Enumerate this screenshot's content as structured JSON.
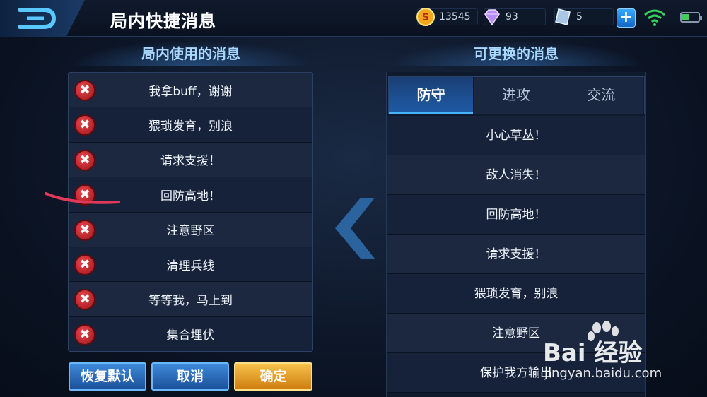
{
  "header": {
    "title": "局内快捷消息",
    "back_icon": "back-arrow-icon"
  },
  "resources": {
    "gold": "13545",
    "diamond": "93",
    "voucher": "5"
  },
  "left_panel": {
    "title": "局内使用的消息",
    "remove_glyph": "✖",
    "items": [
      {
        "label": "我拿buff，谢谢"
      },
      {
        "label": "猥琐发育，别浪"
      },
      {
        "label": "请求支援！"
      },
      {
        "label": "回防高地！"
      },
      {
        "label": "注意野区"
      },
      {
        "label": "清理兵线"
      },
      {
        "label": "等等我，马上到"
      },
      {
        "label": "集合埋伏"
      }
    ]
  },
  "buttons": {
    "reset": "恢复默认",
    "cancel": "取消",
    "confirm": "确定"
  },
  "right_panel": {
    "title": "可更换的消息",
    "tabs": [
      {
        "label": "防守",
        "active": true
      },
      {
        "label": "进攻",
        "active": false
      },
      {
        "label": "交流",
        "active": false
      }
    ],
    "items": [
      {
        "label": "小心草丛！"
      },
      {
        "label": "敌人消失！"
      },
      {
        "label": "回防高地！"
      },
      {
        "label": "请求支援！"
      },
      {
        "label": "猥琐发育，别浪"
      },
      {
        "label": "注意野区"
      },
      {
        "label": "保护我方输出"
      }
    ]
  },
  "watermark": {
    "brand": "Bai 经验",
    "url": "jingyan.baidu.com"
  },
  "colors": {
    "accent": "#47b4ff",
    "confirm": "#f6c24b",
    "remove": "#d8343a"
  }
}
